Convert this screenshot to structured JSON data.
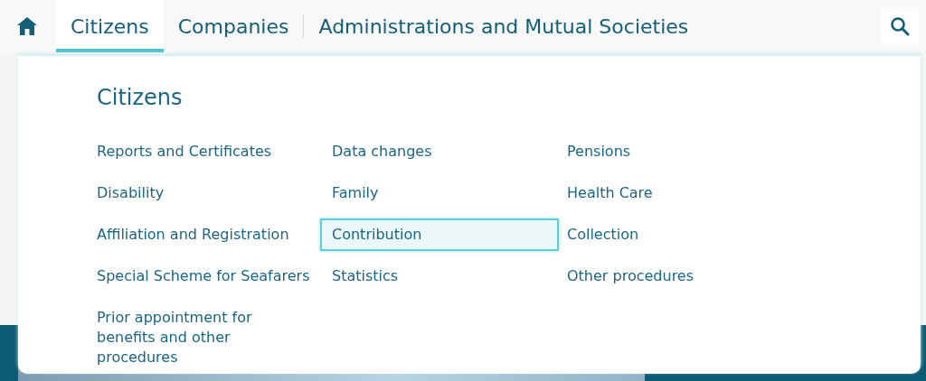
{
  "nav": {
    "tabs": [
      {
        "label": "Citizens",
        "selected": true
      },
      {
        "label": "Companies",
        "selected": false
      },
      {
        "label": "Administrations and Mutual Societies",
        "selected": false
      }
    ]
  },
  "menu": {
    "title": "Citizens",
    "items": [
      {
        "label": "Reports and Certificates",
        "selected": false
      },
      {
        "label": "Data changes",
        "selected": false
      },
      {
        "label": "Pensions",
        "selected": false
      },
      {
        "label": "Disability",
        "selected": false
      },
      {
        "label": "Family",
        "selected": false
      },
      {
        "label": "Health Care",
        "selected": false
      },
      {
        "label": "Affiliation and Registration",
        "selected": false
      },
      {
        "label": "Contribution",
        "selected": true
      },
      {
        "label": "Collection",
        "selected": false
      },
      {
        "label": "Special Scheme for Seafarers",
        "selected": false
      },
      {
        "label": "Statistics",
        "selected": false
      },
      {
        "label": "Other procedures",
        "selected": false
      },
      {
        "label": "Prior appointment for benefits and other procedures",
        "selected": false
      }
    ]
  }
}
